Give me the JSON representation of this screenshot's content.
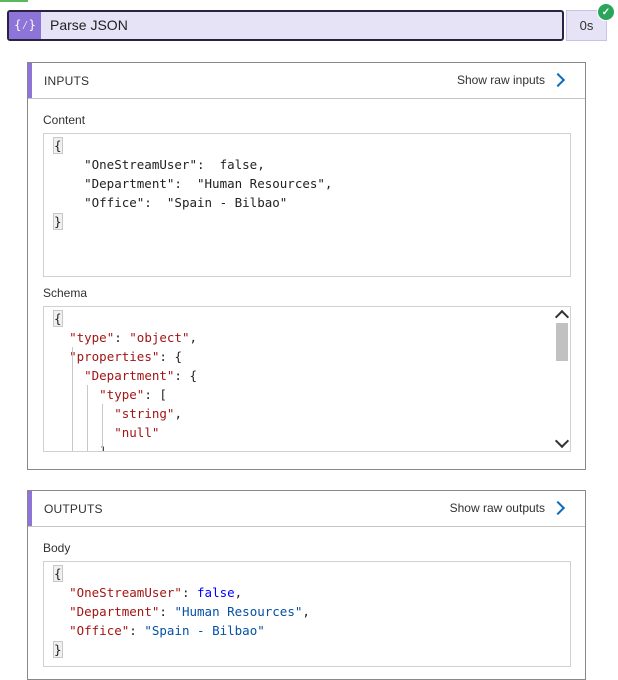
{
  "action": {
    "title": "Parse JSON",
    "icon": "braces-icon",
    "icon_glyph": "{⁄}",
    "duration": "0s",
    "status": "succeeded",
    "accent_color": "#8c74d8"
  },
  "inputs": {
    "title": "INPUTS",
    "raw_link": "Show raw inputs",
    "content_label": "Content",
    "content_lines": [
      {
        "open": "{"
      },
      {
        "k": "    \"OneStreamUser\":",
        "v": "  false,"
      },
      {
        "k": "    \"Department\":",
        "v": "  \"Human Resources\","
      },
      {
        "k": "    \"Office\":",
        "v": "  \"Spain - Bilbao\""
      },
      {
        "close": "}"
      }
    ],
    "schema_label": "Schema",
    "schema_lines": [
      {
        "text": "{"
      },
      {
        "indent": "  ",
        "k": "\"type\"",
        "sep": ": ",
        "v": "\"object\"",
        "tail": ","
      },
      {
        "indent": "  ",
        "k": "\"properties\"",
        "sep": ": ",
        "v": "",
        "tail": "{"
      },
      {
        "indent": "    ",
        "k": "\"Department\"",
        "sep": ": ",
        "v": "",
        "tail": "{"
      },
      {
        "indent": "      ",
        "k": "\"type\"",
        "sep": ": ",
        "v": "",
        "tail": "["
      },
      {
        "indent": "        ",
        "k": "",
        "sep": "",
        "v": "\"string\"",
        "tail": ","
      },
      {
        "indent": "        ",
        "k": "",
        "sep": "",
        "v": "\"null\"",
        "tail": ""
      },
      {
        "indent": "      ",
        "k": "",
        "sep": "",
        "v": "",
        "tail": "],"
      }
    ]
  },
  "outputs": {
    "title": "OUTPUTS",
    "raw_link": "Show raw outputs",
    "body_label": "Body",
    "body_lines": [
      {
        "text": "{"
      },
      {
        "indent": "  ",
        "k": "\"OneStreamUser\"",
        "sep": ": ",
        "v": "false",
        "type": "bool",
        "tail": ","
      },
      {
        "indent": "  ",
        "k": "\"Department\"",
        "sep": ": ",
        "v": "\"Human Resources\"",
        "type": "str",
        "tail": ","
      },
      {
        "indent": "  ",
        "k": "\"Office\"",
        "sep": ": ",
        "v": "\"Spain - Bilbao\"",
        "type": "str",
        "tail": ""
      },
      {
        "text": "}"
      }
    ]
  }
}
